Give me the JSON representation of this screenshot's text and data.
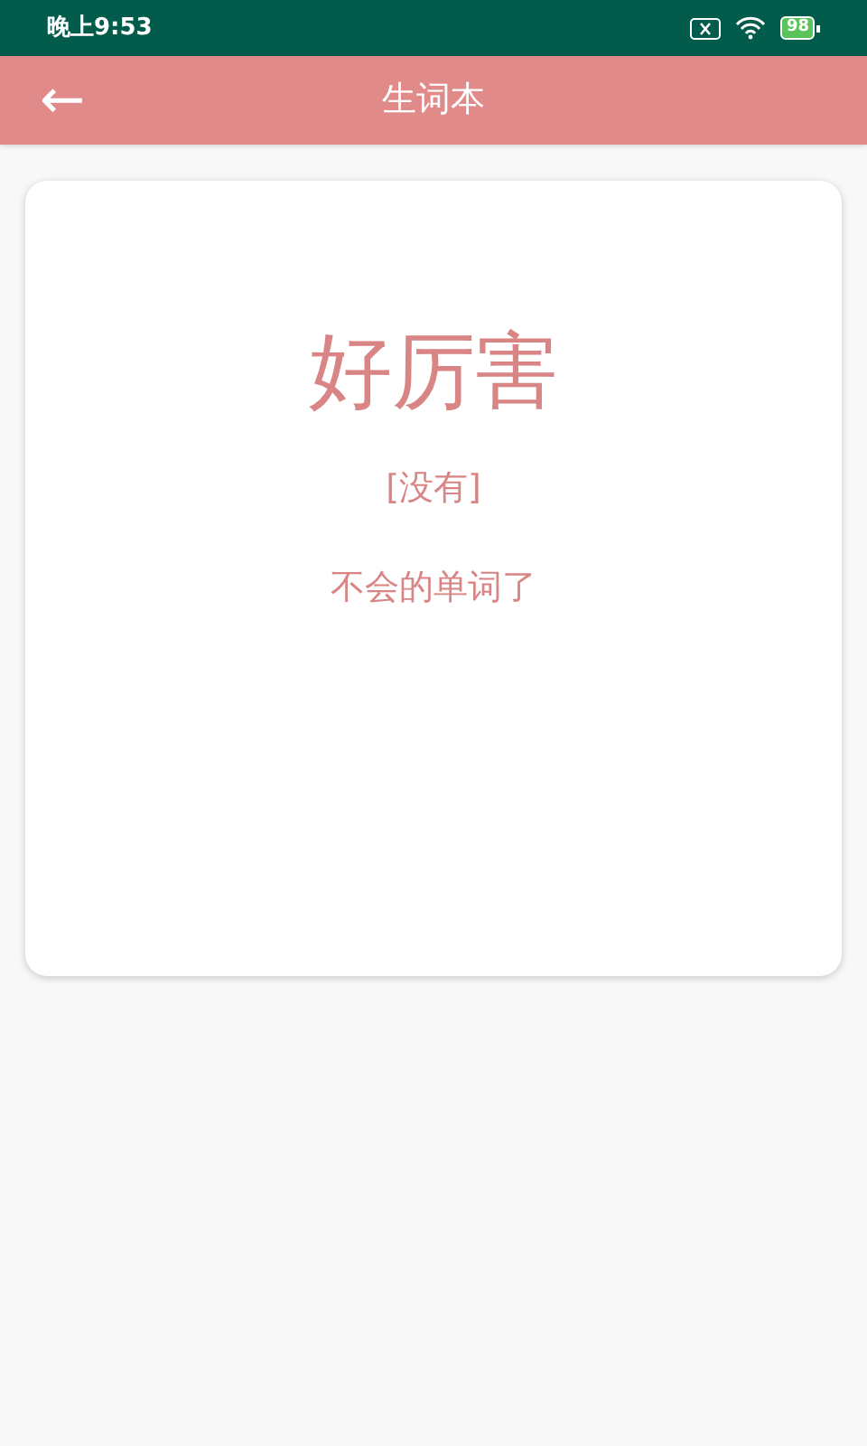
{
  "status_bar": {
    "time": "晚上9:53",
    "battery": "98"
  },
  "header": {
    "back": "←",
    "title": "生词本"
  },
  "card": {
    "word": "好厉害",
    "phonetic": "[没有]",
    "meaning": "不会的单词了"
  }
}
